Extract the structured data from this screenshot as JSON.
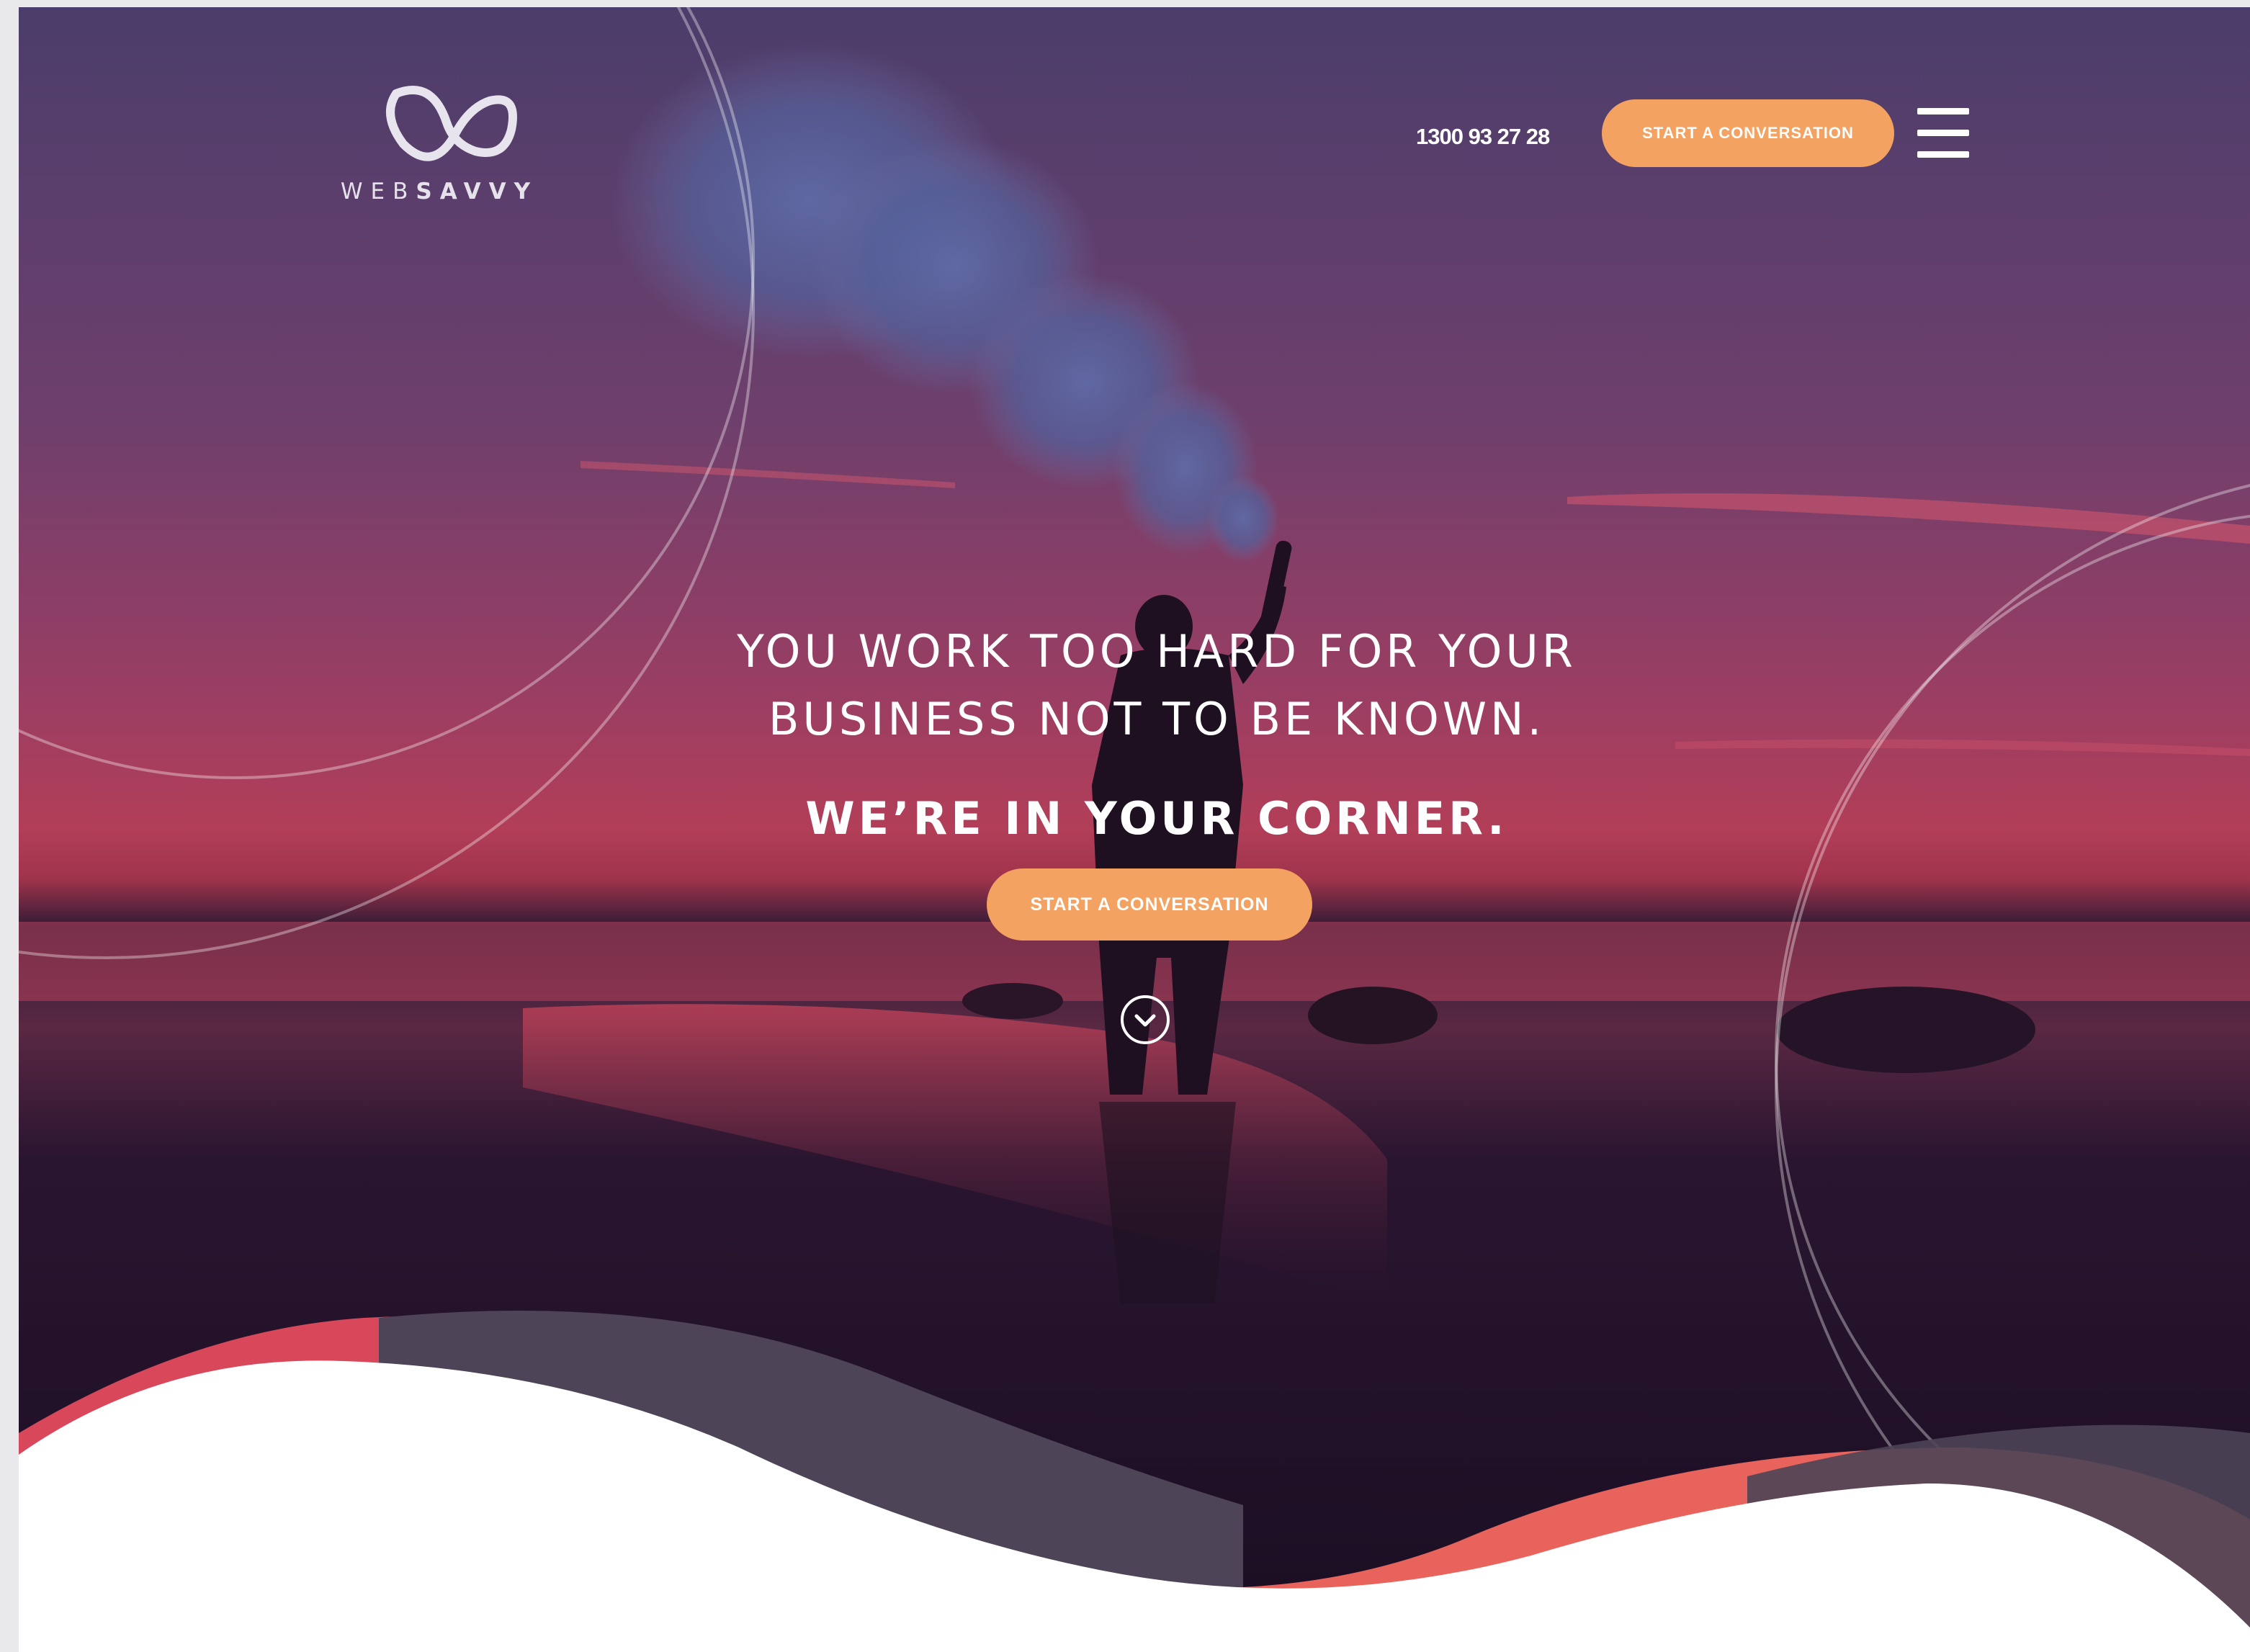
{
  "brand": {
    "logo_text_light": "WEB",
    "logo_text_bold": "SAVVY"
  },
  "header": {
    "phone": "1300 93 27 28",
    "cta_label": "START A CONVERSATION",
    "menu_icon": "hamburger-menu-icon"
  },
  "hero": {
    "headline_line1": "YOU WORK TOO HARD FOR YOUR",
    "headline_line2": "BUSINESS NOT TO BE KNOWN.",
    "subhead": "WE’RE IN YOUR CORNER.",
    "cta_label": "START A CONVERSATION",
    "scroll_icon": "chevron-down-circle-icon"
  },
  "colors": {
    "accent": "#f4a261",
    "sky_top": "#4a3866",
    "sky_mid": "#a03a5c",
    "wave_red": "#d9485a",
    "wave_coral": "#e8635c",
    "wave_slate": "#4d4457"
  }
}
